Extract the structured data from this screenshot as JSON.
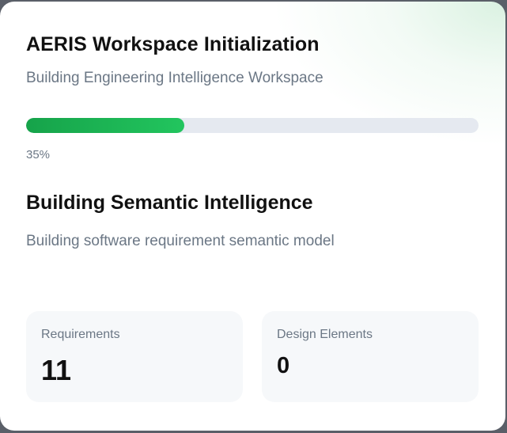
{
  "header": {
    "title": "AERIS Workspace Initialization",
    "subtitle": "Building Engineering Intelligence Workspace"
  },
  "progress": {
    "percent": 35,
    "label": "35%",
    "fill_color": "#22c55e",
    "track_color": "#e5e9f0"
  },
  "phase": {
    "title": "Building Semantic Intelligence",
    "description": "Building software requirement semantic model"
  },
  "stats": [
    {
      "label": "Requirements",
      "value": "11"
    },
    {
      "label": "Design Elements",
      "value": "0"
    }
  ]
}
